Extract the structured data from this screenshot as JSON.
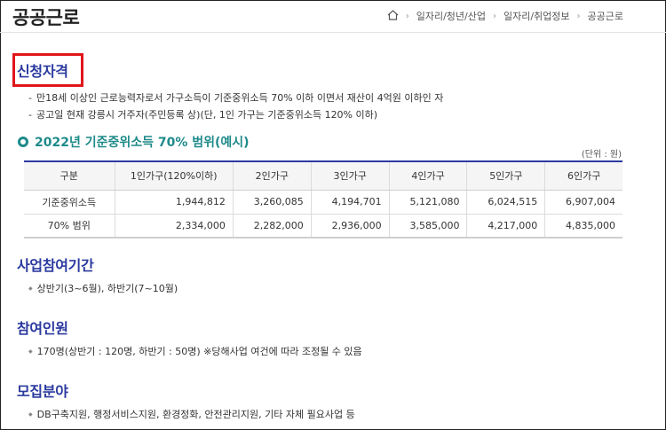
{
  "header": {
    "title": "공공근로",
    "breadcrumb": [
      "일자리/청년/산업",
      "일자리/취업정보",
      "공공근로"
    ]
  },
  "eligibility": {
    "title": "신청자격",
    "items": [
      "만18세 이상인 근로능력자로서 가구소득이 기준중위소득 70% 이하 이면서 재산이 4억원 이하인 자",
      "공고일 현재 강릉시 거주자(주민등록 상)(단, 1인 가구는 기준중위소득 120% 이하)"
    ]
  },
  "income_table": {
    "title": "2022년 기준중위소득 70% 범위(예시)",
    "unit": "(단위 : 원)",
    "headers": [
      "구분",
      "1인가구(120%이하)",
      "2인가구",
      "3인가구",
      "4인가구",
      "5인가구",
      "6인가구"
    ],
    "rows": [
      [
        "기준중위소득",
        "1,944,812",
        "3,260,085",
        "4,194,701",
        "5,121,080",
        "6,024,515",
        "6,907,004"
      ],
      [
        "70% 범위",
        "2,334,000",
        "2,282,000",
        "2,936,000",
        "3,585,000",
        "4,217,000",
        "4,835,000"
      ]
    ]
  },
  "period": {
    "title": "사업참여기간",
    "text": "상반기(3~6월), 하반기(7~10월)"
  },
  "participants": {
    "title": "참여인원",
    "text": "170명(상반기 : 120명, 하반기 : 50명) ※당해사업 여건에 따라 조정될 수 있음"
  },
  "fields": {
    "title": "모집분야",
    "text": "DB구축지원, 행정서비스지원, 환경정화, 안전관리지원, 기타 자체 필요사업 등"
  },
  "colors": {
    "section_title": "#2b3a9f",
    "sub_title": "#1f8a8a",
    "highlight": "#e0161b"
  }
}
